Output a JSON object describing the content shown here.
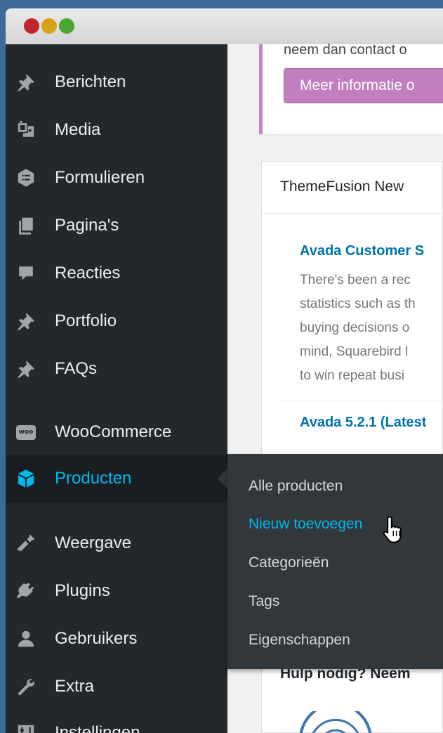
{
  "sidebar": {
    "items": [
      {
        "label": "Berichten",
        "icon": "pin-icon"
      },
      {
        "label": "Media",
        "icon": "media-icon"
      },
      {
        "label": "Formulieren",
        "icon": "forms-icon"
      },
      {
        "label": "Pagina's",
        "icon": "pages-icon"
      },
      {
        "label": "Reacties",
        "icon": "comments-icon"
      },
      {
        "label": "Portfolio",
        "icon": "pin-icon"
      },
      {
        "label": "FAQs",
        "icon": "pin-icon"
      },
      {
        "label": "WooCommerce",
        "icon": "woocommerce-icon",
        "badge": "woo"
      },
      {
        "label": "Producten",
        "icon": "product-box-icon"
      },
      {
        "label": "Weergave",
        "icon": "appearance-icon"
      },
      {
        "label": "Plugins",
        "icon": "plugins-icon"
      },
      {
        "label": "Gebruikers",
        "icon": "users-icon"
      },
      {
        "label": "Extra",
        "icon": "tools-icon"
      },
      {
        "label": "Instellingen",
        "icon": "settings-icon"
      }
    ],
    "active": "Producten"
  },
  "flyout": {
    "items": [
      {
        "label": "Alle producten"
      },
      {
        "label": "Nieuw toevoegen"
      },
      {
        "label": "Categorieën"
      },
      {
        "label": "Tags"
      },
      {
        "label": "Eigenschappen"
      }
    ],
    "hovered": "Nieuw toevoegen"
  },
  "notice": {
    "text": "neem dan contact o",
    "button_label": "Meer informatie o"
  },
  "news": {
    "title": "ThemeFusion New",
    "article_title": "Avada Customer S",
    "article_lines": [
      "There's been a rec",
      "statistics such as th",
      "buying decisions o",
      "mind, Squarebird l",
      "to win repeat busi"
    ],
    "next_article_title": "Avada 5.2.1 (Latest"
  },
  "help": {
    "title": "Hulp nodig? Neem"
  },
  "colors": {
    "sidebar_bg": "#23282d",
    "accent": "#00b9eb",
    "flyout_bg": "#32373c",
    "notice_button": "#c27fc0"
  }
}
